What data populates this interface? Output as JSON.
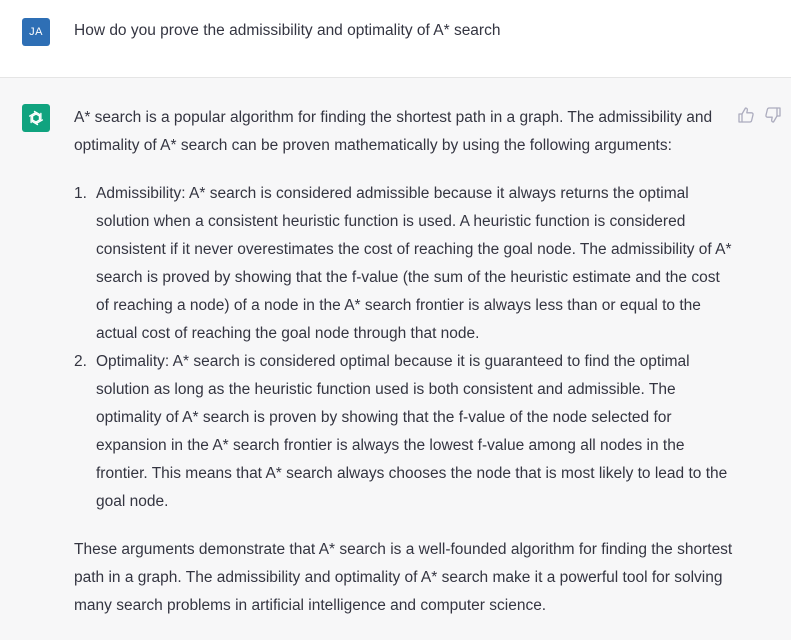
{
  "user": {
    "avatar_initials": "JA",
    "message": "How do you prove the admissibility and optimality of A* search"
  },
  "assistant": {
    "avatar_icon": "openai-logo-icon",
    "intro": "A* search is a popular algorithm for finding the shortest path in a graph. The admissibility and optimality of A* search can be proven mathematically by using the following arguments:",
    "items": [
      {
        "number": "1.",
        "text": "Admissibility: A* search is considered admissible because it always returns the optimal solution when a consistent heuristic function is used. A heuristic function is considered consistent if it never overestimates the cost of reaching the goal node. The admissibility of A* search is proved by showing that the f-value (the sum of the heuristic estimate and the cost of reaching a node) of a node in the A* search frontier is always less than or equal to the actual cost of reaching the goal node through that node."
      },
      {
        "number": "2.",
        "text": "Optimality: A* search is considered optimal because it is guaranteed to find the optimal solution as long as the heuristic function used is both consistent and admissible. The optimality of A* search is proven by showing that the f-value of the node selected for expansion in the A* search frontier is always the lowest f-value among all nodes in the frontier. This means that A* search always chooses the node that is most likely to lead to the goal node."
      }
    ],
    "conclusion": "These arguments demonstrate that A* search is a well-founded algorithm for finding the shortest path in a graph. The admissibility and optimality of A* search make it a powerful tool for solving many search problems in artificial intelligence and computer science."
  },
  "feedback": {
    "up_icon": "thumbs-up-icon",
    "down_icon": "thumbs-down-icon"
  },
  "colors": {
    "user_avatar": "#2e6fb5",
    "bot_avatar": "#10a37f",
    "assistant_bg": "#f7f7f8"
  }
}
